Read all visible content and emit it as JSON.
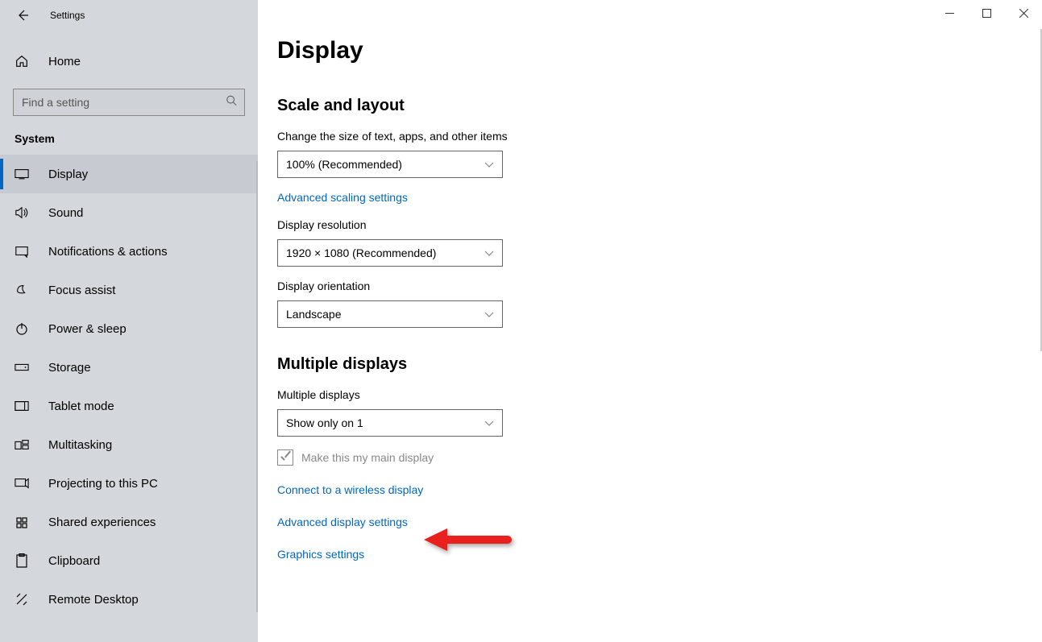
{
  "window": {
    "title": "Settings"
  },
  "sidebar": {
    "home_label": "Home",
    "search_placeholder": "Find a setting",
    "category": "System",
    "items": [
      {
        "label": "Display"
      },
      {
        "label": "Sound"
      },
      {
        "label": "Notifications & actions"
      },
      {
        "label": "Focus assist"
      },
      {
        "label": "Power & sleep"
      },
      {
        "label": "Storage"
      },
      {
        "label": "Tablet mode"
      },
      {
        "label": "Multitasking"
      },
      {
        "label": "Projecting to this PC"
      },
      {
        "label": "Shared experiences"
      },
      {
        "label": "Clipboard"
      },
      {
        "label": "Remote Desktop"
      }
    ]
  },
  "main": {
    "page_title": "Display",
    "section1_title": "Scale and layout",
    "scale_label": "Change the size of text, apps, and other items",
    "scale_value": "100% (Recommended)",
    "adv_scaling_link": "Advanced scaling settings",
    "resolution_label": "Display resolution",
    "resolution_value": "1920 × 1080 (Recommended)",
    "orientation_label": "Display orientation",
    "orientation_value": "Landscape",
    "section2_title": "Multiple displays",
    "multi_label": "Multiple displays",
    "multi_value": "Show only on 1",
    "main_display_checkbox": "Make this my main display",
    "wireless_link": "Connect to a wireless display",
    "adv_display_link": "Advanced display settings",
    "graphics_link": "Graphics settings"
  }
}
